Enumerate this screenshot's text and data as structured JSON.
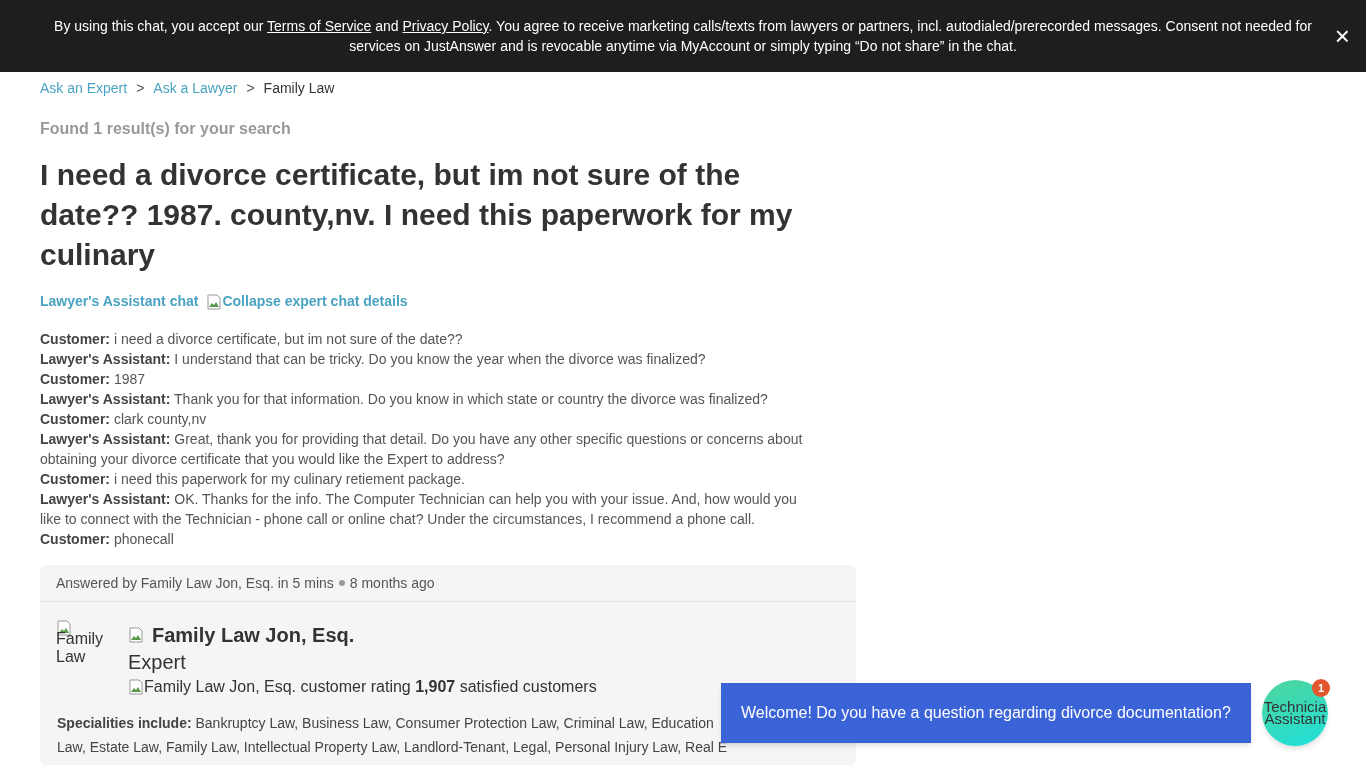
{
  "consent_banner": {
    "parts": [
      {
        "text": "By using this chat, you accept our",
        "link": false
      },
      {
        "text": "Terms of Service",
        "link": true
      },
      {
        "text": "and",
        "link": false
      },
      {
        "text": "Privacy Policy",
        "link": true
      },
      {
        "text": ". You agree to receive marketing calls/texts from lawyers or partners, incl. autodialed/prerecorded messages. Consent not needed for services on JustAnswer and is revocable anytime via MyAccount or simply typing “Do not share” in the chat.",
        "link": false
      }
    ],
    "close": "×"
  },
  "breadcrumbs": [
    {
      "label": "Ask an Expert",
      "link": true
    },
    {
      "label": "Ask a Lawyer",
      "link": true
    },
    {
      "label": "Family Law",
      "link": false
    }
  ],
  "breadcrumb_separator": ">",
  "results_count": "Found 1 result(s) for your search",
  "title": "I need a divorce certificate, but im not sure of the date?? 1987. county,nv. I need this paperwork for my culinary",
  "chat_link": "Lawyer's Assistant chat",
  "collapse_link": "Collapse expert chat details",
  "messages": [
    {
      "speaker": "Customer:",
      "text": "i need a divorce certificate, but im not sure of the date??"
    },
    {
      "speaker": "Lawyer's Assistant:",
      "text": "I understand that can be tricky. Do you know the year when the divorce was finalized?"
    },
    {
      "speaker": "Customer:",
      "text": "1987"
    },
    {
      "speaker": "Lawyer's Assistant:",
      "text": "Thank you for that information. Do you know in which state or country the divorce was finalized?"
    },
    {
      "speaker": "Customer:",
      "text": "clark county,nv"
    },
    {
      "speaker": "Lawyer's Assistant:",
      "text": "Great, thank you for providing that detail. Do you have any other specific questions or concerns about obtaining your divorce certificate that you would like the Expert to address?"
    },
    {
      "speaker": "Customer:",
      "text": "i need this paperwork for my culinary retiement package."
    },
    {
      "speaker": "Lawyer's Assistant:",
      "text": "OK. Thanks for the info. The Computer Technician can help you with your issue. And, how would you like to connect with the Technician - phone call or online chat? Under the circumstances, I recommend a phone call."
    },
    {
      "speaker": "Customer:",
      "text": "phonecall"
    }
  ],
  "answer": {
    "answered_by": "Answered by Family Law Jon, Esq. in 5 mins",
    "time": "8 months ago",
    "avatar_alt": "Family Law",
    "name": "Family Law Jon, Esq.",
    "role": "Expert",
    "rating": "Family Law Jon, Esq. customer rating **1,907** satisfied customers",
    "specialities_label": "Specialities include:",
    "specialities_lines": [
      "Bankruptcy Law, Business Law, Consumer Protection Law, Criminal Law, Education",
      "Law, Estate Law, Family Law, Intellectual Property Law, Landlord-Tenant, Legal, Personal Injury Law, Real E"
    ]
  },
  "chat_popup": {
    "message": "Welcome! Do you have a question regarding divorce documentation?",
    "avatar_alt": "Technicia Assistant",
    "badge": "1"
  }
}
